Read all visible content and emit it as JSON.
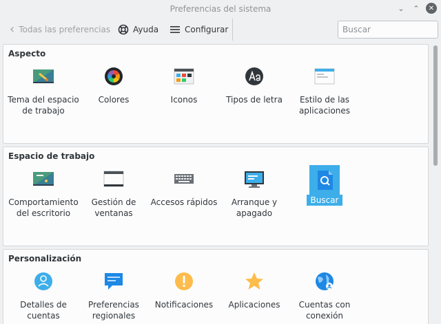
{
  "window": {
    "title": "Preferencias del sistema"
  },
  "toolbar": {
    "back_label": "Todas las preferencias",
    "help_label": "Ayuda",
    "config_label": "Configurar",
    "search_placeholder": "Buscar"
  },
  "sections": [
    {
      "title": "Aspecto",
      "items": [
        {
          "label": "Tema del espacio de trabajo",
          "icon": "desktop-theme-icon"
        },
        {
          "label": "Colores",
          "icon": "colors-icon"
        },
        {
          "label": "Iconos",
          "icon": "icons-icon"
        },
        {
          "label": "Tipos de letra",
          "icon": "fonts-icon"
        },
        {
          "label": "Estilo de las aplicaciones",
          "icon": "app-style-icon"
        }
      ]
    },
    {
      "title": "Espacio de trabajo",
      "items": [
        {
          "label": "Comportamiento del escritorio",
          "icon": "desktop-behavior-icon"
        },
        {
          "label": "Gestión de ventanas",
          "icon": "window-management-icon"
        },
        {
          "label": "Accesos rápidos",
          "icon": "shortcuts-keyboard-icon"
        },
        {
          "label": "Arranque y apagado",
          "icon": "startup-shutdown-icon"
        },
        {
          "label": "Buscar",
          "icon": "search-files-icon"
        }
      ]
    },
    {
      "title": "Personalización",
      "items": [
        {
          "label": "Detalles de cuentas",
          "icon": "user-account-icon"
        },
        {
          "label": "Preferencias regionales",
          "icon": "regional-chat-icon"
        },
        {
          "label": "Notificaciones",
          "icon": "notification-icon"
        },
        {
          "label": "Aplicaciones",
          "icon": "applications-star-icon"
        },
        {
          "label": "Cuentas con conexión",
          "icon": "online-accounts-icon"
        }
      ]
    }
  ],
  "colors": {
    "accent": "#3daee9",
    "window_bg": "#eff0f1",
    "panel_bg": "#fcfcfc"
  }
}
